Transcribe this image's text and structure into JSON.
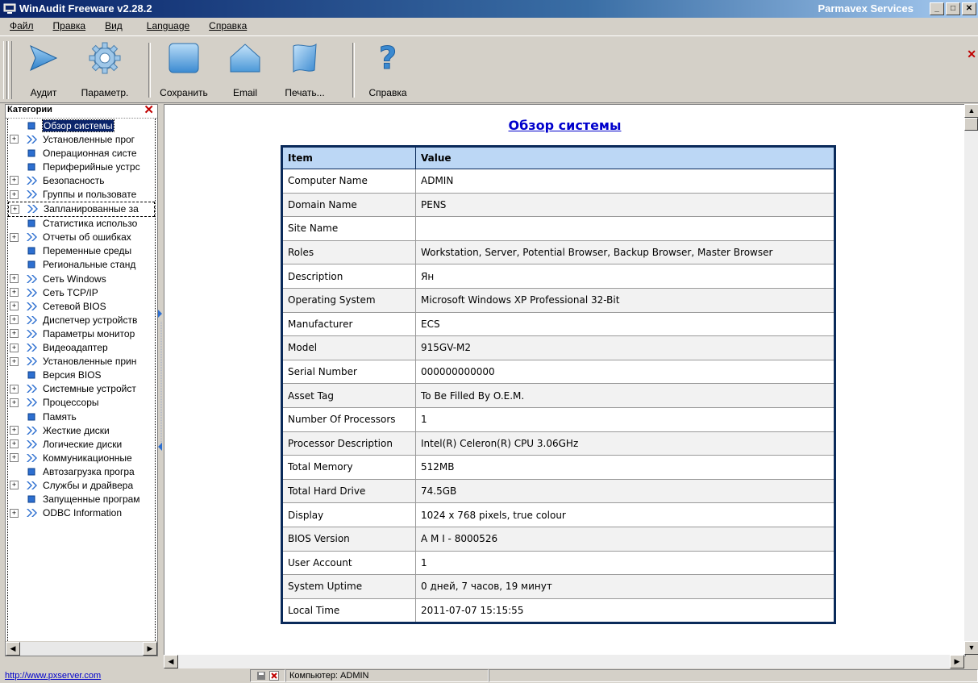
{
  "window": {
    "title": "WinAudit Freeware v2.28.2",
    "company": "Parmavex Services",
    "minimize": "_",
    "maximize": "□",
    "close": "✕"
  },
  "menu": {
    "items": [
      "Файл",
      "Правка",
      "Вид",
      "Language",
      "Справка"
    ]
  },
  "toolbar": {
    "buttons": [
      {
        "label": "Аудит",
        "icon": "play-arrow-icon"
      },
      {
        "label": "Параметр.",
        "icon": "gear-icon"
      },
      {
        "label": "Сохранить",
        "icon": "save-icon"
      },
      {
        "label": "Email",
        "icon": "email-icon"
      },
      {
        "label": "Печать...",
        "icon": "print-icon"
      },
      {
        "label": "Справка",
        "icon": "help-icon"
      }
    ],
    "close": "✕"
  },
  "sidebar": {
    "header": "Категории",
    "close": "✕",
    "items": [
      {
        "label": "Обзор системы",
        "expandable": false
      },
      {
        "label": "Установленные прог",
        "expandable": true
      },
      {
        "label": "Операционная систе",
        "expandable": false
      },
      {
        "label": "Периферийные устрс",
        "expandable": false
      },
      {
        "label": "Безопасность",
        "expandable": true
      },
      {
        "label": "Группы и пользовате",
        "expandable": true
      },
      {
        "label": "Запланированные за",
        "expandable": true
      },
      {
        "label": "Статистика использо",
        "expandable": false
      },
      {
        "label": "Отчеты об ошибках",
        "expandable": true
      },
      {
        "label": "Переменные среды",
        "expandable": false
      },
      {
        "label": "Региональные станд",
        "expandable": false
      },
      {
        "label": "Сеть Windows",
        "expandable": true
      },
      {
        "label": "Сеть TCP/IP",
        "expandable": true
      },
      {
        "label": "Сетевой BIOS",
        "expandable": true
      },
      {
        "label": "Диспетчер устройств",
        "expandable": true
      },
      {
        "label": "Параметры монитор",
        "expandable": true
      },
      {
        "label": "Видеоадаптер",
        "expandable": true
      },
      {
        "label": "Установленные прин",
        "expandable": true
      },
      {
        "label": "Версия BIOS",
        "expandable": false
      },
      {
        "label": "Системные устройст",
        "expandable": true
      },
      {
        "label": "Процессоры",
        "expandable": true
      },
      {
        "label": "Память",
        "expandable": false
      },
      {
        "label": "Жесткие диски",
        "expandable": true
      },
      {
        "label": "Логические диски",
        "expandable": true
      },
      {
        "label": "Коммуникационные",
        "expandable": true
      },
      {
        "label": "Автозагрузка програ",
        "expandable": false
      },
      {
        "label": "Службы и драйвера",
        "expandable": true
      },
      {
        "label": "Запущенные програм",
        "expandable": false
      },
      {
        "label": "ODBC Information",
        "expandable": true
      }
    ]
  },
  "main": {
    "title": "Обзор системы",
    "table": {
      "headers": [
        "Item",
        "Value"
      ],
      "rows": [
        [
          "Computer Name",
          "ADMIN"
        ],
        [
          "Domain Name",
          "PENS"
        ],
        [
          "Site Name",
          ""
        ],
        [
          "Roles",
          "Workstation, Server, Potential Browser, Backup Browser, Master Browser"
        ],
        [
          "Description",
          "Ян"
        ],
        [
          "Operating System",
          "Microsoft Windows XP Professional 32-Bit"
        ],
        [
          "Manufacturer",
          "ECS"
        ],
        [
          "Model",
          "915GV-M2"
        ],
        [
          "Serial Number",
          "000000000000"
        ],
        [
          "Asset Tag",
          "To Be Filled By O.E.M."
        ],
        [
          "Number Of Processors",
          "1"
        ],
        [
          "Processor Description",
          "Intel(R) Celeron(R) CPU 3.06GHz"
        ],
        [
          "Total Memory",
          "512MB"
        ],
        [
          "Total Hard Drive",
          "74.5GB"
        ],
        [
          "Display",
          "1024 x 768 pixels, true colour"
        ],
        [
          "BIOS Version",
          "A M I - 8000526"
        ],
        [
          "User Account",
          "1"
        ],
        [
          "System Uptime",
          "0 дней, 7 часов, 19 минут"
        ],
        [
          "Local Time",
          "2011-07-07 15:15:55"
        ]
      ]
    }
  },
  "status": {
    "link": "http://www.pxserver.com",
    "computer": "Компьютер: ADMIN"
  },
  "colors": {
    "title_bar": "#0a246a",
    "header_row": "#bcd7f5",
    "link": "#0000cc",
    "table_border": "#0a2a5a"
  }
}
